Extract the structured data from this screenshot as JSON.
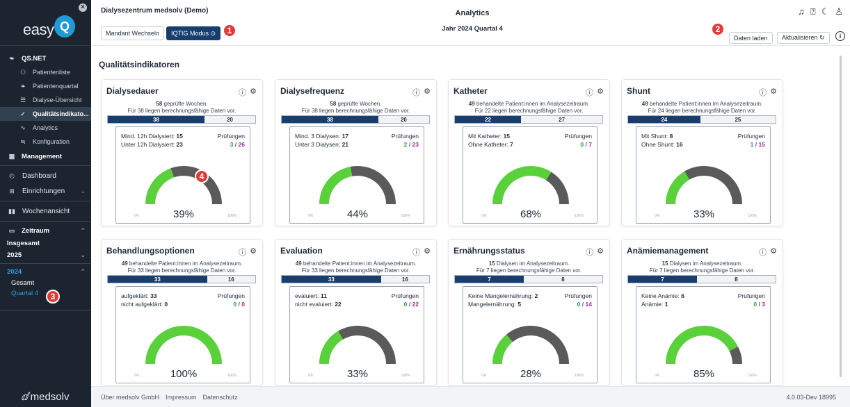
{
  "sidebar": {
    "logo_text": "easy",
    "logo_q": "Q",
    "logo_close": "×",
    "qs_label": "QS.NET",
    "qs_items": [
      {
        "label": "Patientenliste",
        "icon": "user-list-icon",
        "glyph": "⚇"
      },
      {
        "label": "Patientenquartal",
        "icon": "kidney-icon",
        "glyph": "❧"
      },
      {
        "label": "Dialyse-Übersicht",
        "icon": "list-icon",
        "glyph": "☰"
      },
      {
        "label": "Qualitätsindikato...",
        "icon": "shield-check-icon",
        "glyph": "✓"
      },
      {
        "label": "Analytics",
        "icon": "line-chart-icon",
        "glyph": "∿"
      },
      {
        "label": "Konfiguration",
        "icon": "sliders-icon",
        "glyph": "≒"
      }
    ],
    "management_label": "Management",
    "dashboard_label": "Dashboard",
    "einrichtungen_label": "Einrichtungen",
    "wochenansicht_label": "Wochenansicht",
    "zeitraum_label": "Zeitraum",
    "insgesamt_label": "Insgesamt",
    "year_2025": "2025",
    "year_2024": "2024",
    "gesamt_label": "Gesamt",
    "quartal_label": "Quartal 4",
    "bottom_brand": "medsolv"
  },
  "header": {
    "tenant": "Dialysezentrum medsolv (Demo)",
    "mandant_button": "Mandant Wechseln",
    "iqtig_button": "IQTIG Modus ⊙",
    "title": "Analytics",
    "subtitle": "Jahr 2024 Quartal 4",
    "daten_laden": "Daten laden",
    "aktualisieren": "Aktualisieren ↻",
    "icons": [
      "bell-icon",
      "help-icon",
      "moon-icon",
      "user-icon"
    ]
  },
  "badges": [
    "1",
    "2",
    "3",
    "4"
  ],
  "main": {
    "title": "Qualitätsindikatoren",
    "pruefungen_label": "Prüfungen"
  },
  "cards": [
    {
      "title": "Dialysedauer",
      "line1_num": "58",
      "line1_rest": " geprüfte Wochen.",
      "line2": "Für 38 liegen berechnungsfähige Daten vor.",
      "bar_a": "38",
      "bar_b": "20",
      "row1_label": "Mind. 12h Dialysiert:",
      "row1_val": "15",
      "row2_label": "Unter 12h Dialysiert:",
      "row2_val": "23",
      "pr_a": "3",
      "pr_b": "26",
      "pct_text": "39%",
      "pct": 39
    },
    {
      "title": "Dialysefrequenz",
      "line1_num": "58",
      "line1_rest": " geprüfte Wochen.",
      "line2": "Für 38 liegen berechnungsfähige Daten vor.",
      "bar_a": "38",
      "bar_b": "20",
      "row1_label": "Mind. 3 Dialysen:",
      "row1_val": "17",
      "row2_label": "Unter 3 Dialysen:",
      "row2_val": "21",
      "pr_a": "2",
      "pr_b": "23",
      "pct_text": "44%",
      "pct": 44
    },
    {
      "title": "Katheter",
      "line1_num": "49",
      "line1_rest": " behandelte Patient:innen im Analysezeitraum.",
      "line2": "Für 22 liegen berechnungsfähige Daten vor.",
      "bar_a": "22",
      "bar_b": "27",
      "row1_label": "Mit Katheter:",
      "row1_val": "15",
      "row2_label": "Ohne Katheter:",
      "row2_val": "7",
      "pr_a": "0",
      "pr_b": "7",
      "pct_text": "68%",
      "pct": 68
    },
    {
      "title": "Shunt",
      "line1_num": "49",
      "line1_rest": " behandelte Patient:innen im Analysezeitraum.",
      "line2": "Für 24 liegen berechnungsfähige Daten vor.",
      "bar_a": "24",
      "bar_b": "25",
      "row1_label": "Mit Shunt:",
      "row1_val": "8",
      "row2_label": "Ohne Shunt:",
      "row2_val": "16",
      "pr_a": "1",
      "pr_b": "15",
      "pct_text": "33%",
      "pct": 33
    },
    {
      "title": "Behandlungsoptionen",
      "line1_num": "49",
      "line1_rest": " behandelte Patient:innen im Analysezeitraum.",
      "line2": "Für 33 liegen berechnungsfähige Daten vor.",
      "bar_a": "33",
      "bar_b": "16",
      "row1_label": "aufgeklärt:",
      "row1_val": "33",
      "row2_label": "nicht aufgeklärt:",
      "row2_val": "0",
      "pr_a": "0",
      "pr_b": "0",
      "pct_text": "100%",
      "pct": 100
    },
    {
      "title": "Evaluation",
      "line1_num": "49",
      "line1_rest": " behandelte Patient:innen im Analysezeitraum.",
      "line2": "Für 33 liegen berechnungsfähige Daten vor.",
      "bar_a": "33",
      "bar_b": "16",
      "row1_label": "evaluiert:",
      "row1_val": "11",
      "row2_label": "nicht evaluiert:",
      "row2_val": "22",
      "pr_a": "0",
      "pr_b": "22",
      "pct_text": "33%",
      "pct": 33
    },
    {
      "title": "Ernährungsstatus",
      "line1_num": "15",
      "line1_rest": " Dialysen im Analysezeitraum.",
      "line2": "Für 7 liegen berechnungsfähige Daten vor.",
      "bar_a": "7",
      "bar_b": "8",
      "row1_label": "Keine Mangelernährung:",
      "row1_val": "2",
      "row2_label": "Mangelernährung:",
      "row2_val": "5",
      "pr_a": "0",
      "pr_b": "14",
      "pct_text": "28%",
      "pct": 28
    },
    {
      "title": "Anämiemanagement",
      "line1_num": "15",
      "line1_rest": " Dialysen im Analysezeitraum.",
      "line2": "Für 7 liegen berechnungsfähige Daten vor.",
      "bar_a": "7",
      "bar_b": "8",
      "row1_label": "Keine Anämie:",
      "row1_val": "6",
      "row2_label": "Anämie:",
      "row2_val": "1",
      "pr_a": "0",
      "pr_b": "3",
      "pct_text": "85%",
      "pct": 85
    }
  ],
  "gauge": {
    "min_label": "0%",
    "max_label": "100%",
    "fill_color": "#5ad13a",
    "track_color": "#5a5a5a"
  },
  "footer": {
    "links": [
      "Über medsolv GmbH",
      "Impressum",
      "Datenschutz"
    ],
    "version": "4.0.03-Dev 18995"
  }
}
